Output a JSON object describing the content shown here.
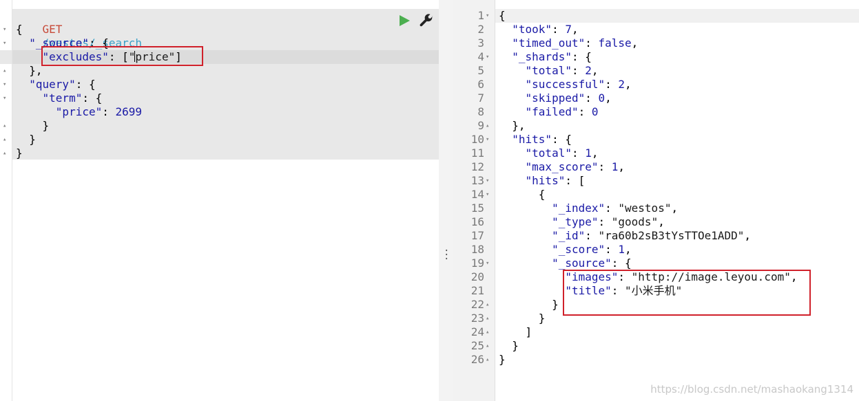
{
  "request": {
    "method": "GET",
    "path": "/westos/_search",
    "lines": [
      {
        "tokens": [
          [
            "punc",
            "{"
          ]
        ]
      },
      {
        "tokens": [
          [
            "punc",
            "  "
          ],
          [
            "key",
            "\"_source\""
          ],
          [
            "punc",
            ": {"
          ]
        ]
      },
      {
        "tokens": [
          [
            "punc",
            "    "
          ],
          [
            "key",
            "\"excludes\""
          ],
          [
            "punc",
            ": ["
          ],
          [
            "str",
            "\"price\""
          ],
          [
            "punc",
            "]"
          ]
        ]
      },
      {
        "tokens": [
          [
            "punc",
            "  },"
          ]
        ]
      },
      {
        "tokens": [
          [
            "punc",
            "  "
          ],
          [
            "key",
            "\"query\""
          ],
          [
            "punc",
            ": {"
          ]
        ]
      },
      {
        "tokens": [
          [
            "punc",
            "    "
          ],
          [
            "key",
            "\"term\""
          ],
          [
            "punc",
            ": {"
          ]
        ]
      },
      {
        "tokens": [
          [
            "punc",
            "      "
          ],
          [
            "key",
            "\"price\""
          ],
          [
            "punc",
            ": "
          ],
          [
            "num",
            "2699"
          ]
        ]
      },
      {
        "tokens": [
          [
            "punc",
            "    }"
          ]
        ]
      },
      {
        "tokens": [
          [
            "punc",
            "  }"
          ]
        ]
      },
      {
        "tokens": [
          [
            "punc",
            "}"
          ]
        ]
      }
    ]
  },
  "toolbar": {
    "play_icon": "play-triangle",
    "wrench_icon": "wrench"
  },
  "response": {
    "lines": [
      {
        "n": "1",
        "fold": "down",
        "tokens": [
          [
            "punc",
            "{"
          ]
        ]
      },
      {
        "n": "2",
        "tokens": [
          [
            "punc",
            "  "
          ],
          [
            "key",
            "\"took\""
          ],
          [
            "punc",
            ": "
          ],
          [
            "num",
            "7"
          ],
          [
            "punc",
            ","
          ]
        ]
      },
      {
        "n": "3",
        "tokens": [
          [
            "punc",
            "  "
          ],
          [
            "key",
            "\"timed_out\""
          ],
          [
            "punc",
            ": "
          ],
          [
            "bool",
            "false"
          ],
          [
            "punc",
            ","
          ]
        ]
      },
      {
        "n": "4",
        "fold": "down",
        "tokens": [
          [
            "punc",
            "  "
          ],
          [
            "key",
            "\"_shards\""
          ],
          [
            "punc",
            ": {"
          ]
        ]
      },
      {
        "n": "5",
        "tokens": [
          [
            "punc",
            "    "
          ],
          [
            "key",
            "\"total\""
          ],
          [
            "punc",
            ": "
          ],
          [
            "num",
            "2"
          ],
          [
            "punc",
            ","
          ]
        ]
      },
      {
        "n": "6",
        "tokens": [
          [
            "punc",
            "    "
          ],
          [
            "key",
            "\"successful\""
          ],
          [
            "punc",
            ": "
          ],
          [
            "num",
            "2"
          ],
          [
            "punc",
            ","
          ]
        ]
      },
      {
        "n": "7",
        "tokens": [
          [
            "punc",
            "    "
          ],
          [
            "key",
            "\"skipped\""
          ],
          [
            "punc",
            ": "
          ],
          [
            "num",
            "0"
          ],
          [
            "punc",
            ","
          ]
        ]
      },
      {
        "n": "8",
        "tokens": [
          [
            "punc",
            "    "
          ],
          [
            "key",
            "\"failed\""
          ],
          [
            "punc",
            ": "
          ],
          [
            "num",
            "0"
          ]
        ]
      },
      {
        "n": "9",
        "fold": "up",
        "tokens": [
          [
            "punc",
            "  },"
          ]
        ]
      },
      {
        "n": "10",
        "fold": "down",
        "tokens": [
          [
            "punc",
            "  "
          ],
          [
            "key",
            "\"hits\""
          ],
          [
            "punc",
            ": {"
          ]
        ]
      },
      {
        "n": "11",
        "tokens": [
          [
            "punc",
            "    "
          ],
          [
            "key",
            "\"total\""
          ],
          [
            "punc",
            ": "
          ],
          [
            "num",
            "1"
          ],
          [
            "punc",
            ","
          ]
        ]
      },
      {
        "n": "12",
        "tokens": [
          [
            "punc",
            "    "
          ],
          [
            "key",
            "\"max_score\""
          ],
          [
            "punc",
            ": "
          ],
          [
            "num",
            "1"
          ],
          [
            "punc",
            ","
          ]
        ]
      },
      {
        "n": "13",
        "fold": "down",
        "tokens": [
          [
            "punc",
            "    "
          ],
          [
            "key",
            "\"hits\""
          ],
          [
            "punc",
            ": ["
          ]
        ]
      },
      {
        "n": "14",
        "fold": "down",
        "tokens": [
          [
            "punc",
            "      {"
          ]
        ]
      },
      {
        "n": "15",
        "tokens": [
          [
            "punc",
            "        "
          ],
          [
            "key",
            "\"_index\""
          ],
          [
            "punc",
            ": "
          ],
          [
            "str",
            "\"westos\""
          ],
          [
            "punc",
            ","
          ]
        ]
      },
      {
        "n": "16",
        "tokens": [
          [
            "punc",
            "        "
          ],
          [
            "key",
            "\"_type\""
          ],
          [
            "punc",
            ": "
          ],
          [
            "str",
            "\"goods\""
          ],
          [
            "punc",
            ","
          ]
        ]
      },
      {
        "n": "17",
        "tokens": [
          [
            "punc",
            "        "
          ],
          [
            "key",
            "\"_id\""
          ],
          [
            "punc",
            ": "
          ],
          [
            "str",
            "\"ra60b2sB3tYsTTOe1ADD\""
          ],
          [
            "punc",
            ","
          ]
        ]
      },
      {
        "n": "18",
        "tokens": [
          [
            "punc",
            "        "
          ],
          [
            "key",
            "\"_score\""
          ],
          [
            "punc",
            ": "
          ],
          [
            "num",
            "1"
          ],
          [
            "punc",
            ","
          ]
        ]
      },
      {
        "n": "19",
        "fold": "down",
        "tokens": [
          [
            "punc",
            "        "
          ],
          [
            "key",
            "\"_source\""
          ],
          [
            "punc",
            ": {"
          ]
        ]
      },
      {
        "n": "20",
        "tokens": [
          [
            "punc",
            "          "
          ],
          [
            "key",
            "\"images\""
          ],
          [
            "punc",
            ": "
          ],
          [
            "str",
            "\"http://image.leyou.com\""
          ],
          [
            "punc",
            ","
          ]
        ]
      },
      {
        "n": "21",
        "tokens": [
          [
            "punc",
            "          "
          ],
          [
            "key",
            "\"title\""
          ],
          [
            "punc",
            ": "
          ],
          [
            "str",
            "\"小米手机\""
          ]
        ]
      },
      {
        "n": "22",
        "fold": "up",
        "tokens": [
          [
            "punc",
            "        }"
          ]
        ]
      },
      {
        "n": "23",
        "fold": "up",
        "tokens": [
          [
            "punc",
            "      }"
          ]
        ]
      },
      {
        "n": "24",
        "fold": "up",
        "tokens": [
          [
            "punc",
            "    ]"
          ]
        ]
      },
      {
        "n": "25",
        "fold": "up",
        "tokens": [
          [
            "punc",
            "  }"
          ]
        ]
      },
      {
        "n": "26",
        "fold": "up",
        "tokens": [
          [
            "punc",
            "}"
          ]
        ]
      }
    ]
  },
  "colors": {
    "highlight_box": "#d0202a",
    "method": "#c74b3a",
    "path": "#3aa0c7",
    "json_key": "#1a1aa6",
    "play": "#4caf50"
  },
  "watermark": "https://blog.csdn.net/mashaokang1314"
}
